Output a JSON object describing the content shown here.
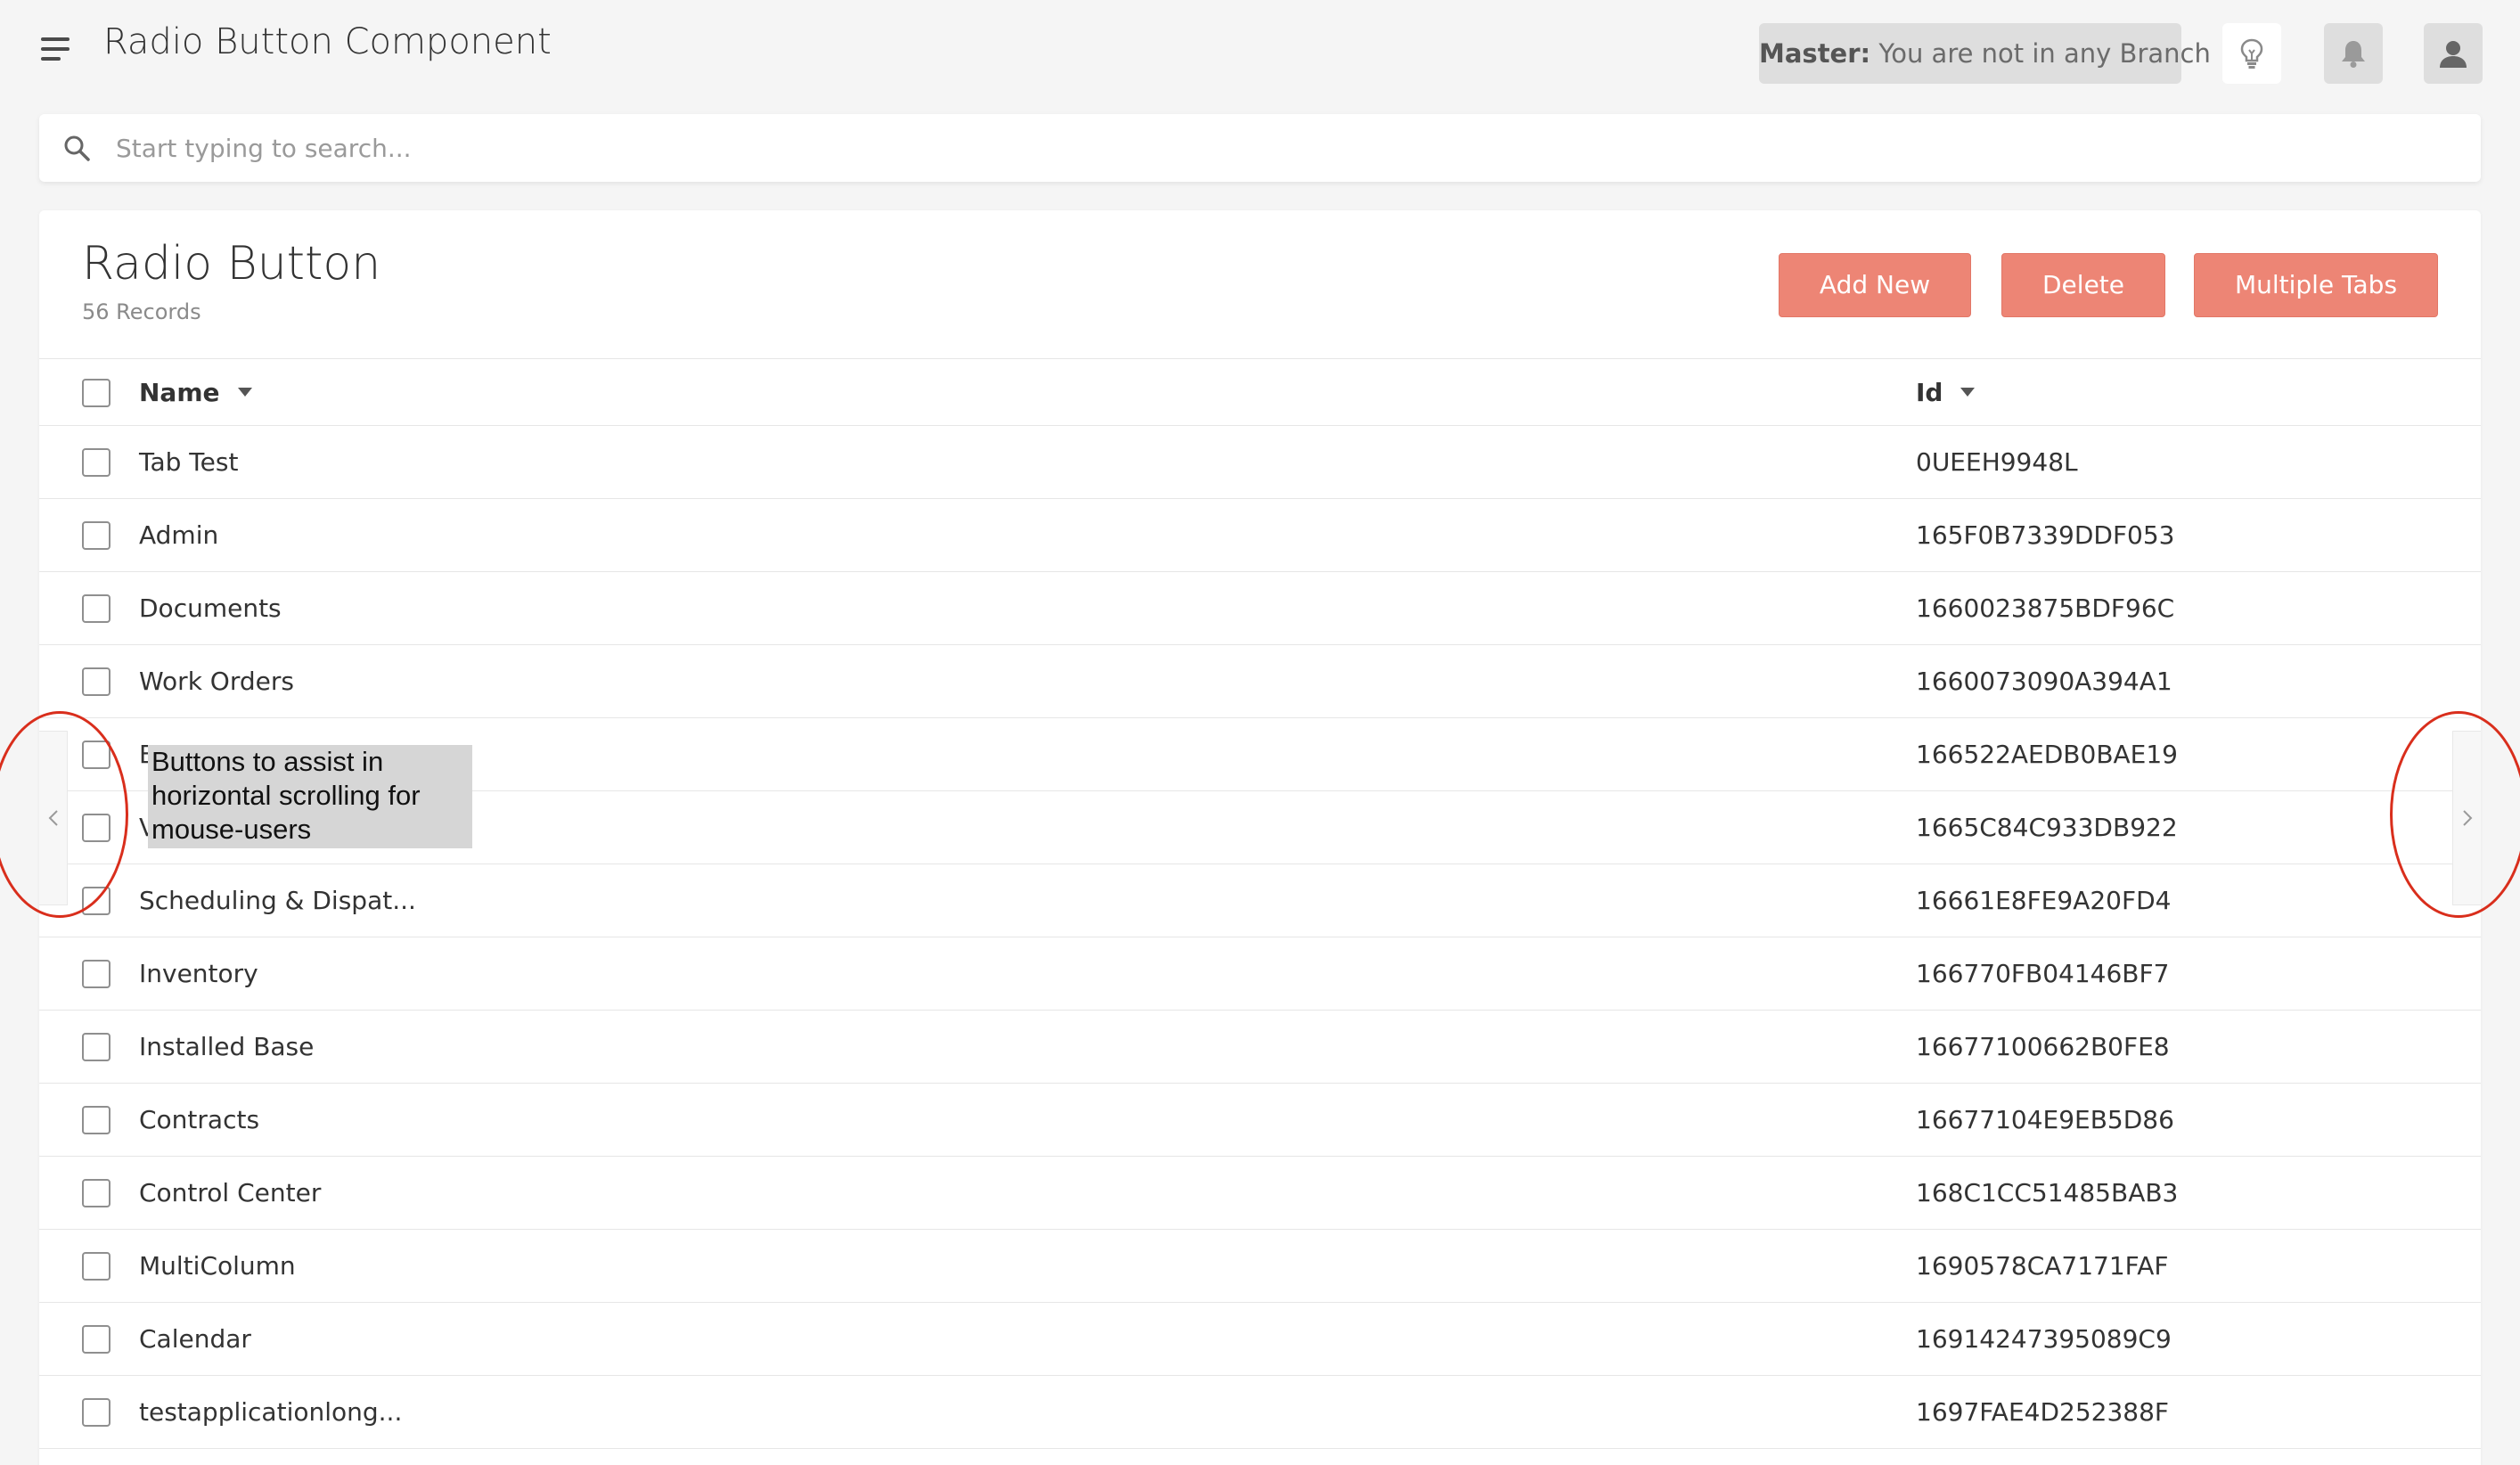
{
  "header": {
    "title": "Radio Button Component",
    "menu_icon": "hamburger-menu-icon",
    "branch": {
      "label": "Master:",
      "text": "You are not in any Branch"
    },
    "icons": [
      "lightbulb-icon",
      "bell-icon",
      "user-icon"
    ]
  },
  "search": {
    "placeholder": "Start typing to search...",
    "value": ""
  },
  "page": {
    "title": "Radio Button",
    "records": "56 Records",
    "buttons": {
      "add_new": "Add New",
      "delete": "Delete",
      "multiple_tabs": "Multiple Tabs"
    },
    "accent_color": "#ed8575"
  },
  "table": {
    "columns": {
      "name": "Name",
      "id": "Id"
    },
    "rows": [
      {
        "name": "Tab Test",
        "id": "0UEEH9948L"
      },
      {
        "name": "Admin",
        "id": "165F0B7339DDF053"
      },
      {
        "name": "Documents",
        "id": "1660023875BDF96C"
      },
      {
        "name": "Work Orders",
        "id": "1660073090A394A1"
      },
      {
        "name": "E",
        "id": "166522AEDB0BAE19"
      },
      {
        "name": "V",
        "id": "1665C84C933DB922"
      },
      {
        "name": "Scheduling & Dispat...",
        "id": "16661E8FE9A20FD4"
      },
      {
        "name": "Inventory",
        "id": "166770FB04146BF7"
      },
      {
        "name": "Installed Base",
        "id": "16677100662B0FE8"
      },
      {
        "name": "Contracts",
        "id": "16677104E9EB5D86"
      },
      {
        "name": "Control Center",
        "id": "168C1CC51485BAB3"
      },
      {
        "name": "MultiColumn",
        "id": "1690578CA7171FAF"
      },
      {
        "name": "Calendar",
        "id": "16914247395089C9"
      },
      {
        "name": "testapplicationlong...",
        "id": "1697FAE4D252388F"
      }
    ]
  },
  "annotation": {
    "lines": [
      "Buttons to assist in",
      "horizontal scrolling for",
      "mouse-users"
    ],
    "highlight_color": "#d92e1c"
  }
}
